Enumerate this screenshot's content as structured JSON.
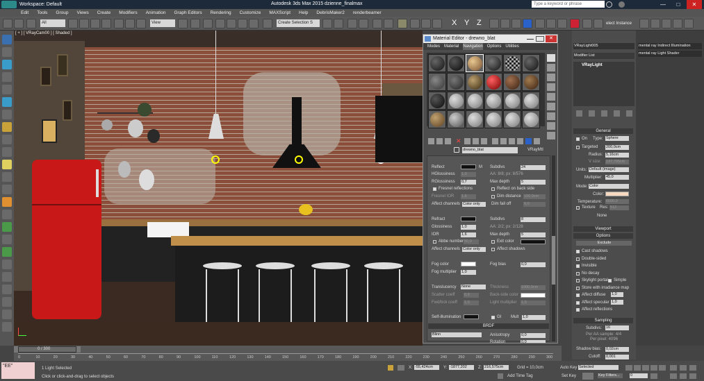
{
  "titlebar": {
    "workspace": "Workspace: Default",
    "title": "Autodesk 3ds Max 2015    dzienne_finalmax",
    "search_placeholder": "Type a keyword or phrase"
  },
  "menubar": {
    "items": [
      "Edit",
      "Tools",
      "Group",
      "Views",
      "Create",
      "Modifiers",
      "Animation",
      "Graph Editors",
      "Rendering",
      "Customize",
      "MAXScript",
      "Help",
      "DebrisMaker2",
      "renderbeamer"
    ]
  },
  "toolbar": {
    "selection_filter": "All",
    "ref_coord": "View",
    "named_selection": "Create Selection S",
    "select_instance": "elect Instance"
  },
  "viewport": {
    "label": "[ + ] [ VRayCam00 ] [ Shaded ]"
  },
  "material_editor": {
    "title": "Material Editor - drewno_blat",
    "menus": [
      "Modes",
      "Material",
      "Navigation",
      "Options",
      "Utilities"
    ],
    "material_name": "drewno_blat",
    "material_type": "VRayMtl",
    "reflect": {
      "reflect_label": "Reflect",
      "hilight_label": "HGlossiness",
      "hilight_value": "1,0",
      "rglossiness_label": "RGlossiness",
      "rglossiness_value": "0,7",
      "fresnel_label": "Fresnel reflections",
      "fresnel_ior_label": "Fresnel IOR",
      "fresnel_ior_value": "1,6",
      "affect_label": "Affect channels",
      "affect_value": "Color only",
      "subdivs_label": "Subdivs",
      "subdivs_value": "24",
      "aa_label": "AA: 8/8; px: 8/576",
      "maxdepth_label": "Max depth",
      "maxdepth_value": "5",
      "backside_label": "Reflect on back side",
      "dimdist_label": "Dim distance",
      "dimdist_value": "100,0cm",
      "dimfall_label": "Dim fall off",
      "dimfall_value": "0,0"
    },
    "refract": {
      "refract_label": "Refract",
      "gloss_label": "Glossiness",
      "gloss_value": "1,0",
      "ior_label": "IOR",
      "ior_value": "1,6",
      "abbe_label": "Abbe number",
      "abbe_value": "50,0",
      "affect_label": "Affect channels",
      "affect_value": "Color only",
      "subdivs_label": "Subdivs",
      "subdivs_value": "8",
      "aa_label": "AA: 2/2; px: 2/128",
      "maxdepth_label": "Max depth",
      "maxdepth_value": "5",
      "exit_label": "Exit color",
      "shadows_label": "Affect shadows"
    },
    "fog": {
      "color_label": "Fog color",
      "mult_label": "Fog multiplier",
      "mult_value": "1,0",
      "bias_label": "Fog bias",
      "bias_value": "0,0"
    },
    "translucency": {
      "label": "Translucency",
      "value": "None",
      "scatter_label": "Scatter coeff",
      "scatter_value": "0,0",
      "fwd_label": "Fwd/bck coeff",
      "fwd_value": "1,0",
      "thickness_label": "Thickness",
      "thickness_value": "1000,0cm",
      "backside_label": "Back-side color",
      "light_mult_label": "Light multiplier",
      "light_mult_value": "1,0"
    },
    "selfillum": {
      "label": "Self-illumination",
      "gi_label": "GI",
      "mult_label": "Mult",
      "mult_value": "1,0"
    },
    "brdf": {
      "section": "BRDF",
      "type": "Blinn",
      "aniso_label": "Anisotropy",
      "aniso_value": "0,0",
      "rotation_label": "Rotation",
      "rotation_value": "0,0"
    }
  },
  "command_panel": {
    "object_name": "VRayLight005",
    "modifier_list": "Modifier List",
    "stack_item": "VRayLight",
    "general": {
      "section": "General",
      "on_label": "On",
      "type_label": "Type:",
      "type_value": "Sphere",
      "targeted_label": "Targeted",
      "targeted_value": "200,0cm",
      "radius_label": "Radius:",
      "radius_value": "5,16cm",
      "vsize_label": "V size:",
      "vsize_value": "137,795cm",
      "units_label": "Units:",
      "units_value": "Default (image)",
      "mult_label": "Multiplier:",
      "mult_value": "45,0",
      "mode_label": "Mode:",
      "mode_value": "Color",
      "color_label": "Color:",
      "temp_label": "Temperature:",
      "temp_value": "6500,0",
      "texture_label": "Texture",
      "res_label": "Res:",
      "res_value": "512",
      "none_label": "None"
    },
    "viewport_section": "Viewport",
    "options": {
      "section": "Options",
      "exclude": "Exclude",
      "items": [
        "Cast shadows",
        "Double-sided",
        "Invisible",
        "No decay",
        "Skylight portal",
        "Store with irradiance map",
        "Affect diffuse",
        "Affect specular",
        "Affect reflections"
      ],
      "checked": [
        true,
        false,
        true,
        false,
        false,
        false,
        true,
        true,
        true
      ],
      "simple_label": "Simple",
      "diffuse_value": "1,0",
      "specular_value": "1,0"
    },
    "sampling": {
      "section": "Sampling",
      "subdivs_label": "Subdivs:",
      "subdivs_value": "16",
      "aa_label": "Per AA sample: 4/4",
      "px_label": "Per pixel: 4096",
      "shadow_bias_label": "Shadow bias:",
      "shadow_bias_value": "0,02cm",
      "cutoff_label": "Cutoff:",
      "cutoff_value": "0,001"
    }
  },
  "mr_panel": {
    "items": [
      "mental ray Indirect Illumination",
      "mental ray Light Shader"
    ]
  },
  "timeline": {
    "frame_counter": "0 / 300",
    "ticks": [
      "0",
      "10",
      "20",
      "30",
      "40",
      "50",
      "60",
      "70",
      "80",
      "90",
      "100",
      "110",
      "120",
      "130",
      "140",
      "150",
      "160",
      "170",
      "180",
      "190",
      "200",
      "210",
      "220",
      "230",
      "240",
      "250",
      "260",
      "270",
      "280",
      "290",
      "300"
    ]
  },
  "status": {
    "lights_selected": "1 Light Selected",
    "prompt": "Click or click-and-drag to select objects",
    "x_label": "X:",
    "x_value": "-55,424cm",
    "y_label": "Y:",
    "y_value": "-1877,202",
    "z_label": "Z:",
    "z_value": "216,575cm",
    "grid": "Grid = 10,0cm",
    "add_time_tag": "Add Time Tag",
    "auto_key": "Auto Key",
    "set_key": "Set Key",
    "selected": "Selected",
    "key_filters": "Key Filters...",
    "frame": "0",
    "maxscript": "\"EE\""
  }
}
